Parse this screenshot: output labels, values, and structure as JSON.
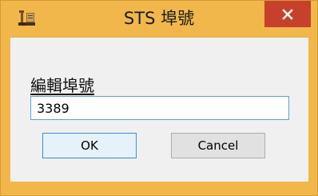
{
  "window": {
    "title": "STS 埠號",
    "app_icon": "sts-app-icon",
    "close_icon": "close-icon"
  },
  "form": {
    "label": "編輯埠號",
    "port_value": "3389"
  },
  "buttons": {
    "ok_label": "OK",
    "cancel_label": "Cancel"
  },
  "colors": {
    "frame": "#f2b74b",
    "close_button": "#c7402c",
    "input_focus_border": "#5ba0dc",
    "default_button_border": "#3c8fd6"
  }
}
